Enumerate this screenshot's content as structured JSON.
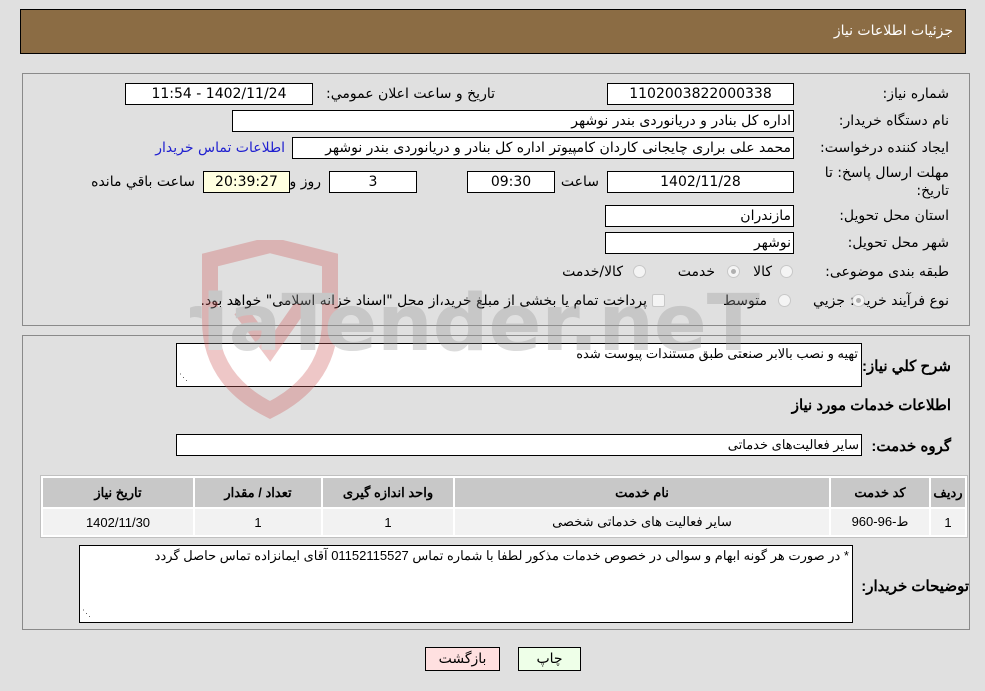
{
  "header": {
    "title": "جزئیات اطلاعات نیاز"
  },
  "details": {
    "need_number_label": "شماره نیاز:",
    "need_number": "1102003822000338",
    "announce_label": "تاریخ و ساعت اعلان عمومي:",
    "announce_value": "1402/11/24 - 11:54",
    "buyer_org_label": "نام دستگاه خریدار:",
    "buyer_org": "اداره کل بنادر و دریانوردی بندر نوشهر",
    "creator_label": "ایجاد کننده درخواست:",
    "creator": "محمد علی براری چایجانی کاردان کامپیوتر اداره کل بنادر و دریانوردی بندر نوشهر",
    "buyer_contact_link": "اطلاعات تماس خریدار",
    "deadline_label": "مهلت ارسال پاسخ: تا تاریخ:",
    "deadline_date": "1402/11/28",
    "time_label": "ساعت",
    "deadline_time": "09:30",
    "days_value": "3",
    "days_label": "روز و",
    "remaining_time": "20:39:27",
    "remaining_label": "ساعت باقي مانده",
    "province_label": "استان محل تحویل:",
    "province": "مازندران",
    "city_label": "شهر محل تحویل:",
    "city": "نوشهر",
    "category_label": "طبقه بندی موضوعی:",
    "category_options": [
      "کالا",
      "خدمت",
      "کالا/خدمت"
    ],
    "category_selected": "خدمت",
    "purchase_type_label": "نوع فرآیند خرید :",
    "purchase_options": [
      "جزيي",
      "متوسط"
    ],
    "treasury_note": "پرداخت تمام یا بخشی از مبلغ خرید،از محل \"اسناد خزانه اسلامی\" خواهد بود."
  },
  "needs": {
    "description_label": "شرح کلي نياز:",
    "description": "تهیه و نصب بالابر صنعتی طبق مستندات پیوست شده",
    "services_heading": "اطلاعات خدمات مورد نیاز",
    "service_group_label": "گروه خدمت:",
    "service_group": "سایر فعالیت‌های خدماتی",
    "table": {
      "headers": [
        "ردیف",
        "کد خدمت",
        "نام خدمت",
        "واحد اندازه گیری",
        "تعداد / مقدار",
        "تاریخ نیاز"
      ],
      "rows": [
        [
          "1",
          "ط-96-960",
          "سایر فعالیت های خدماتی شخصی",
          "1",
          "1",
          "1402/11/30"
        ]
      ]
    },
    "buyer_notes_label": "توضیحات خریدار:",
    "buyer_notes": "* در صورت هر گونه ابهام و سوالی در خصوص خدمات مذکور لطفا با شماره تماس 01152115527 آقای ایمانزاده تماس حاصل گردد"
  },
  "buttons": {
    "print": "چاپ",
    "back": "بازگشت"
  },
  "watermark": {
    "text": "AriaTender.neT"
  }
}
